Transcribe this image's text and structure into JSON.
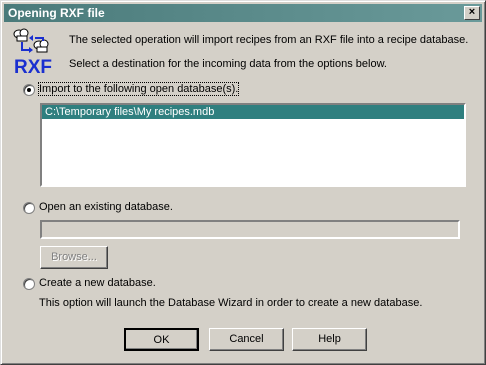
{
  "window": {
    "title": "Opening RXF file",
    "close_glyph": "×"
  },
  "logo": {
    "text": "RXF",
    "icon": "chef-hats-arrows-icon",
    "accent": "#1a2fd0"
  },
  "intro": {
    "line1": "The selected operation will import recipes from an RXF file into a recipe database.",
    "line2": "Select a destination for the incoming data from the options below."
  },
  "options": {
    "import": {
      "label": "Import to the following open database(s).",
      "selected": true
    },
    "open_existing": {
      "label": "Open an existing database.",
      "selected": false
    },
    "create_new": {
      "label": "Create a new database.",
      "selected": false,
      "description": "This option will launch the Database Wizard in order to create a new database."
    }
  },
  "database_list": {
    "items": [
      "C:\\Temporary files\\My recipes.mdb"
    ],
    "selected_color": "#2f7f7f"
  },
  "existing_path": {
    "value": ""
  },
  "buttons": {
    "browse": "Browse...",
    "ok": "OK",
    "cancel": "Cancel",
    "help": "Help"
  }
}
